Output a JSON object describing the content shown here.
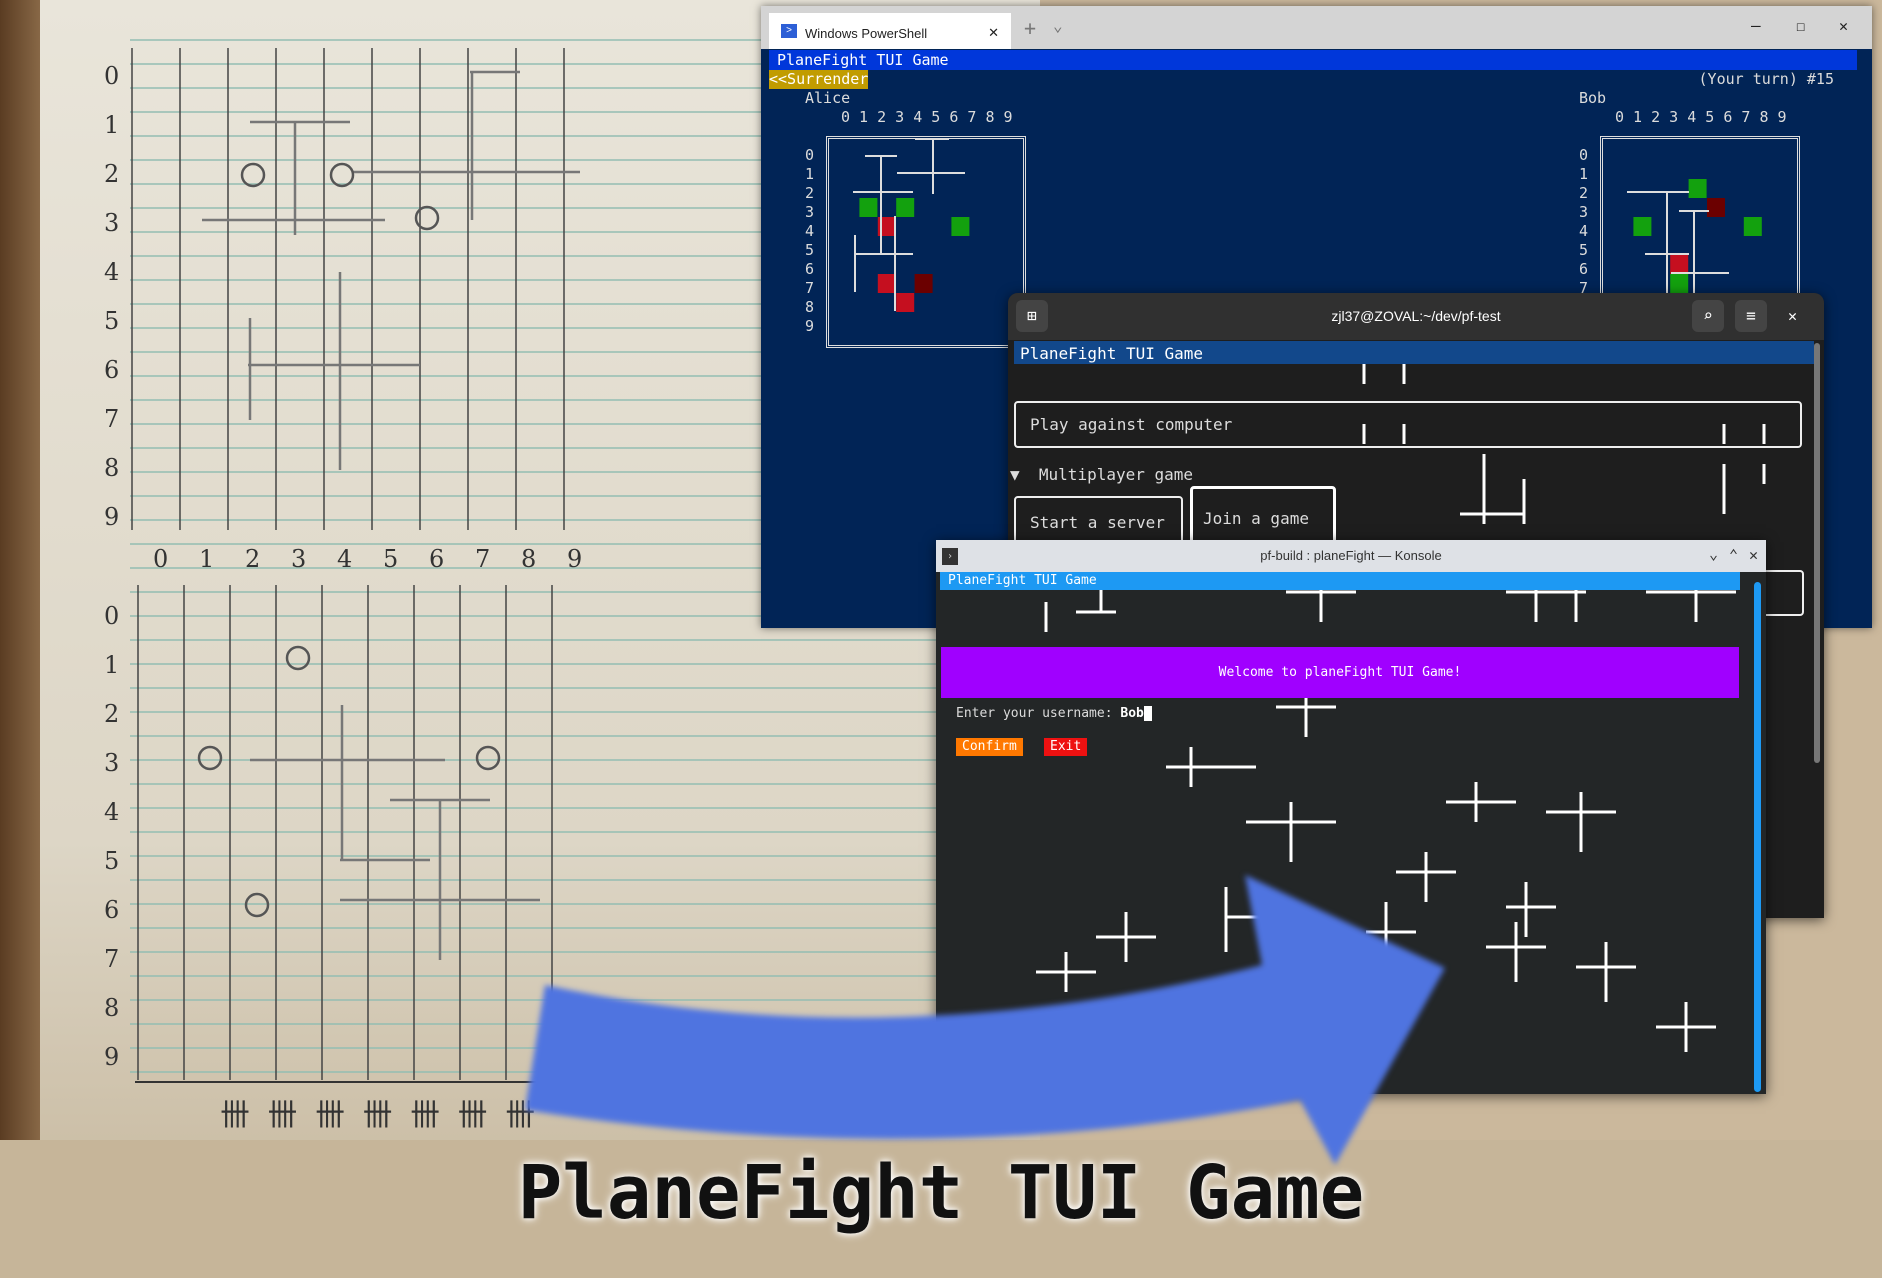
{
  "notebook": {
    "top_rows": [
      "0",
      "1",
      "2",
      "3",
      "4",
      "5",
      "6",
      "7",
      "8",
      "9"
    ],
    "axis_cols": [
      "0",
      "1",
      "2",
      "3",
      "4",
      "5",
      "6",
      "7",
      "8",
      "9"
    ],
    "bottom_rows": [
      "0",
      "1",
      "2",
      "3",
      "4",
      "5",
      "6",
      "7",
      "8",
      "9"
    ],
    "tally": "卌 卌 卌 卌 卌 卌 卌"
  },
  "powershell": {
    "tab_title": "Windows PowerShell",
    "new_tab": "+",
    "dropdown": "⌄",
    "controls": {
      "minimize": "–",
      "maximize": "☐",
      "close": "✕"
    },
    "app_title": "PlaneFight TUI Game",
    "surrender": "<<Surrender",
    "turn_status": "(Your turn) #15",
    "col_header": "0 1 2 3 4 5 6 7 8 9",
    "row_labels": [
      "0",
      "1",
      "2",
      "3",
      "4",
      "5",
      "6",
      "7",
      "8",
      "9"
    ],
    "player_left": {
      "name": "Alice",
      "cells": [
        {
          "r": 2,
          "c": 1,
          "state": "hit"
        },
        {
          "r": 2,
          "c": 3,
          "state": "hit"
        },
        {
          "r": 3,
          "c": 6,
          "state": "hit"
        },
        {
          "r": 3,
          "c": 2,
          "state": "miss"
        },
        {
          "r": 6,
          "c": 2,
          "state": "miss"
        },
        {
          "r": 7,
          "c": 3,
          "state": "miss"
        },
        {
          "r": 6,
          "c": 4,
          "state": "destroyed"
        }
      ]
    },
    "player_right": {
      "name": "Bob",
      "cells": [
        {
          "r": 1,
          "c": 4,
          "state": "hit"
        },
        {
          "r": 3,
          "c": 1,
          "state": "hit"
        },
        {
          "r": 3,
          "c": 7,
          "state": "hit"
        },
        {
          "r": 6,
          "c": 3,
          "state": "hit"
        },
        {
          "r": 2,
          "c": 5,
          "state": "destroyed"
        },
        {
          "r": 7,
          "c": 6,
          "state": "destroyed"
        },
        {
          "r": 5,
          "c": 3,
          "state": "miss"
        }
      ]
    },
    "colors": {
      "bg": "#012456",
      "hit": "#13a10e",
      "miss": "#c50f1f",
      "destroyed": "#6b0000",
      "title_bar": "#0037da",
      "surrender": "#c19c00"
    }
  },
  "gnome": {
    "title": "zjl37@ZOVAL:~/dev/pf-test",
    "app_title": "PlaneFight TUI Game",
    "play_computer": "Play against computer",
    "multiplayer": "Multiplayer game",
    "expand_icon": "▼",
    "start_server": "Start a server",
    "join_game": "Join a game"
  },
  "konsole": {
    "title": "pf-build : planeFight — Konsole",
    "app_title": "PlaneFight TUI Game",
    "welcome": "Welcome to planeFight TUI Game!",
    "prompt": "Enter your username: ",
    "username": "Bob",
    "confirm": "Confirm",
    "exit": "Exit",
    "colors": {
      "banner": "#a000ff",
      "titlebar": "#1d99f3",
      "confirm": "#ff7800",
      "exit": "#ee1111"
    }
  },
  "caption": "PlaneFight TUI Game"
}
